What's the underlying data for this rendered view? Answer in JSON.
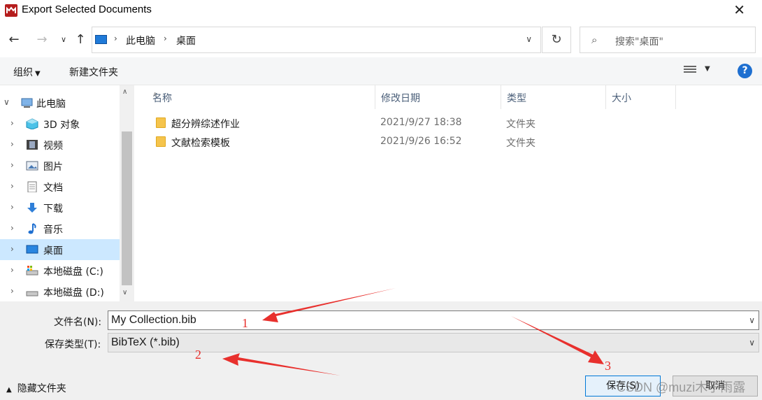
{
  "window": {
    "title": "Export Selected Documents",
    "close_glyph": "✕"
  },
  "nav": {
    "back_glyph": "←",
    "forward_glyph": "→",
    "history_glyph": "∨",
    "up_glyph": "↑",
    "breadcrumb": [
      "此电脑",
      "桌面"
    ],
    "refresh_glyph": "↻",
    "search_placeholder": "搜索\"桌面\""
  },
  "toolbar": {
    "organize_label": "组织",
    "new_folder_label": "新建文件夹",
    "help_glyph": "?"
  },
  "sidebar": {
    "items": [
      {
        "label": "此电脑",
        "icon": "computer-icon",
        "expanded": true
      },
      {
        "label": "3D 对象",
        "icon": "cube-icon"
      },
      {
        "label": "视频",
        "icon": "film-icon"
      },
      {
        "label": "图片",
        "icon": "picture-icon"
      },
      {
        "label": "文档",
        "icon": "document-icon"
      },
      {
        "label": "下载",
        "icon": "download-icon"
      },
      {
        "label": "音乐",
        "icon": "music-note-icon"
      },
      {
        "label": "桌面",
        "icon": "desktop-icon",
        "selected": true
      },
      {
        "label": "本地磁盘 (C:)",
        "icon": "drive-icon"
      },
      {
        "label": "本地磁盘 (D:)",
        "icon": "drive-icon"
      }
    ]
  },
  "filelist": {
    "columns": [
      "名称",
      "修改日期",
      "类型",
      "大小"
    ],
    "rows": [
      {
        "name": "超分辨综述作业",
        "date": "2021/9/27 18:38",
        "type": "文件夹"
      },
      {
        "name": "文献检索模板",
        "date": "2021/9/26 16:52",
        "type": "文件夹"
      }
    ]
  },
  "form": {
    "filename_label": "文件名(N):",
    "filename_value": "My Collection.bib",
    "filetype_label": "保存类型(T):",
    "filetype_value": "BibTeX (*.bib)",
    "hide_folders_label": "隐藏文件夹",
    "save_label": "保存(S)",
    "cancel_label": "取消"
  },
  "annotations": {
    "marker_1": "1",
    "marker_2": "2",
    "marker_3": "3",
    "color": "#e8302d"
  },
  "watermark": "CSDN @muzi木子雨露",
  "colors": {
    "selection": "#cce8ff",
    "accent": "#0078d7",
    "app_icon": "#b51d1d"
  }
}
